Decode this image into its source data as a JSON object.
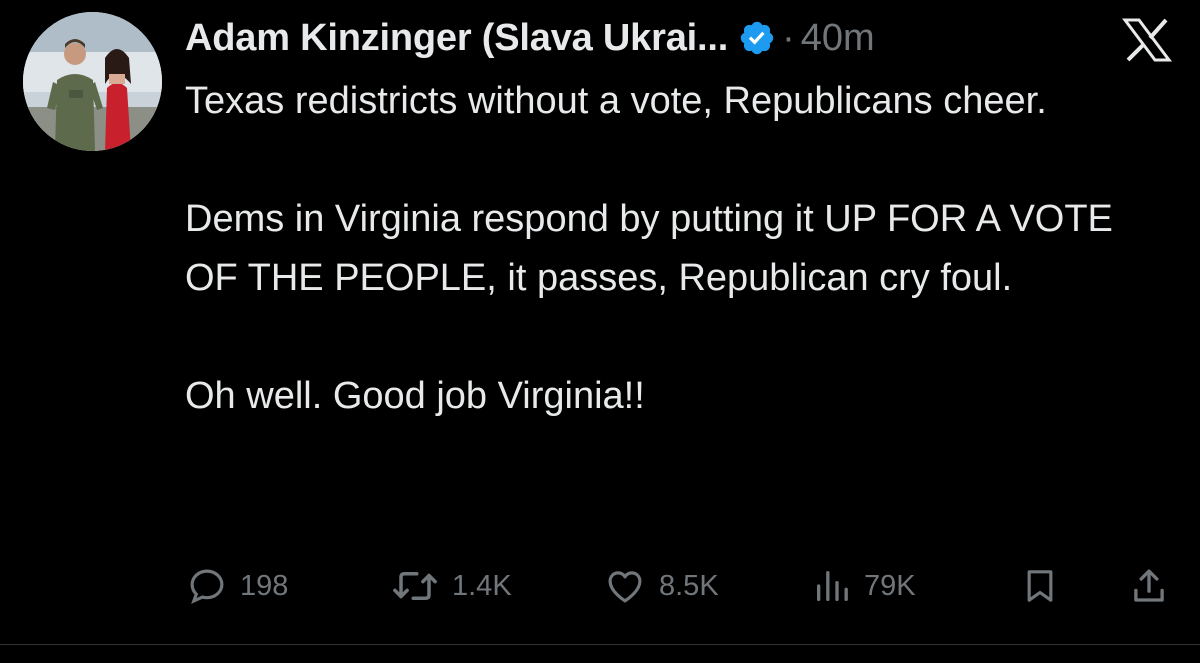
{
  "tweet": {
    "display_name": "Adam Kinzinger (Slava Ukrai...",
    "separator": "·",
    "time": "40m",
    "paragraphs": [
      "Texas redistricts without a vote, Republicans cheer.",
      "Dems in Virginia respond by putting it UP FOR A VOTE OF THE PEOPLE, it passes, Republican cry foul.",
      "Oh well.  Good job Virginia!!"
    ]
  },
  "actions": {
    "replies": "198",
    "reposts": "1.4K",
    "likes": "8.5K",
    "views": "79K"
  },
  "icons": {
    "verified": "verified-badge-icon",
    "platform": "x-logo-icon",
    "reply": "reply-icon",
    "repost": "repost-icon",
    "like": "heart-icon",
    "views": "views-chart-icon",
    "bookmark": "bookmark-icon",
    "share": "share-icon"
  },
  "colors": {
    "background": "#000000",
    "text": "#e7e9ea",
    "muted": "#71767b",
    "verified": "#1d9bf0"
  }
}
